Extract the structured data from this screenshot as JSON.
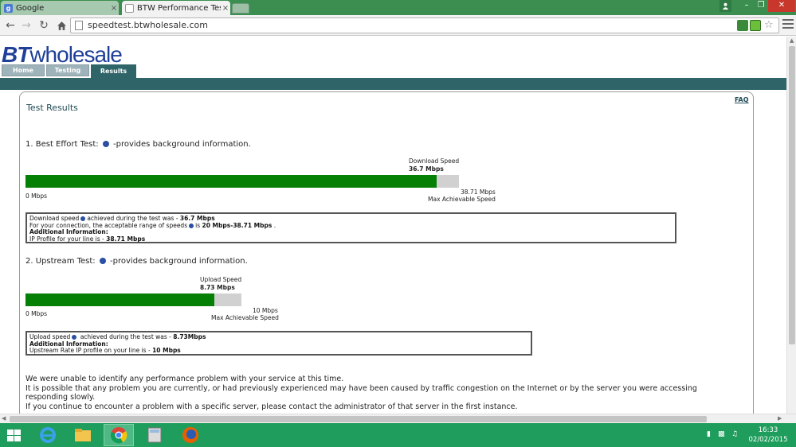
{
  "browser": {
    "tabs": [
      {
        "title": "Google",
        "close": "×"
      },
      {
        "title": "BTW Performance Test",
        "close": "×"
      }
    ],
    "url": "speedtest.btwholesale.com",
    "window_controls": {
      "minimize": "–",
      "maximize": "❐",
      "close": "✕"
    }
  },
  "site": {
    "logo_bt": "BT",
    "logo_rest": "wholesale",
    "nav": {
      "home": "Home",
      "testing": "Testing",
      "results": "Results"
    },
    "faq": "FAQ",
    "page_title": "Test Results"
  },
  "best_effort": {
    "heading_prefix": "1. Best Effort Test:",
    "heading_suffix": "-provides background information.",
    "speed_label": "Download Speed",
    "speed_value": "36.7 Mbps",
    "min_label": "0 Mbps",
    "max_value": "38.71 Mbps",
    "max_label": "Max Achievable Speed",
    "fill_fraction": 0.9481,
    "info": {
      "line1_prefix": "Download speed",
      "line1_mid": "achieved during the test was - ",
      "line1_value": "36.7 Mbps",
      "line2_prefix": "For your connection, the acceptable range of speeds",
      "line2_mid": "is ",
      "line2_value": "20 Mbps-38.71 Mbps",
      "line2_end": " .",
      "additional": "Additional Information:",
      "line4_prefix": "IP Profile for your line is - ",
      "line4_value": "38.71 Mbps"
    }
  },
  "upstream": {
    "heading_prefix": "2. Upstream Test:",
    "heading_suffix": "-provides background information.",
    "speed_label": "Upload Speed",
    "speed_value": "8.73 Mbps",
    "min_label": "0 Mbps",
    "max_value": "10 Mbps",
    "max_label": "Max Achievable Speed",
    "fill_fraction": 0.873,
    "info": {
      "line1_prefix": "Upload speed",
      "line1_mid": " achieved during the test was - ",
      "line1_value": "8.73Mbps",
      "additional": "Additional Information:",
      "line3_prefix": "Upstream Rate IP profile on your line is - ",
      "line3_value": "10 Mbps"
    }
  },
  "message": {
    "line1": "We were unable to identify any performance problem with your service at this time.",
    "line2": "It is possible that any problem you are currently, or had previously experienced may have been caused by traffic congestion on the Internet or by the server you were accessing",
    "line3": "responding slowly.",
    "line4": "If you continue to encounter a problem with a specific server, please contact the administrator of that server in the first instance."
  },
  "taskbar": {
    "time": "16:33",
    "date": "02/02/2015"
  },
  "colors": {
    "bar_fill": "#058005",
    "bar_track": "#d1d1d1",
    "teal": "#2f6468",
    "logo_blue": "#1f3f99",
    "taskbar": "#1f9d5c"
  }
}
